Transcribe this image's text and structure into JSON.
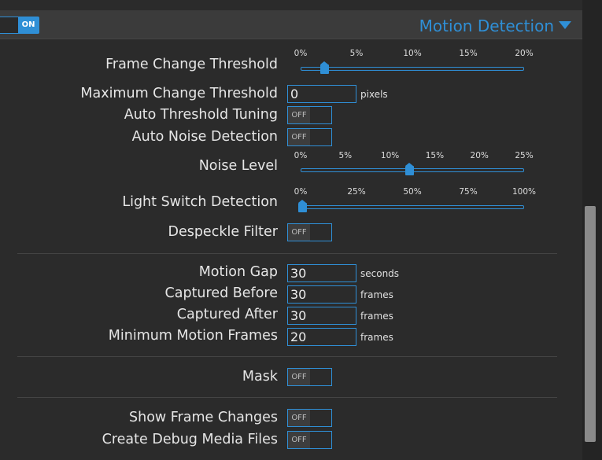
{
  "header": {
    "enable_toggle": "ON",
    "section_title": "Motion Detection"
  },
  "rows": {
    "frame_change_threshold": {
      "label": "Frame Change Threshold",
      "ticks": [
        "0%",
        "5%",
        "10%",
        "15%",
        "20%"
      ],
      "min": 0,
      "max": 20,
      "value": 2
    },
    "max_change_threshold": {
      "label": "Maximum Change Threshold",
      "value": "0",
      "unit": "pixels"
    },
    "auto_threshold_tuning": {
      "label": "Auto Threshold Tuning",
      "state": "OFF"
    },
    "auto_noise_detection": {
      "label": "Auto Noise Detection",
      "state": "OFF"
    },
    "noise_level": {
      "label": "Noise Level",
      "ticks": [
        "0%",
        "5%",
        "10%",
        "15%",
        "20%",
        "25%"
      ],
      "min": 0,
      "max": 25,
      "value": 12
    },
    "light_switch_detection": {
      "label": "Light Switch Detection",
      "ticks": [
        "0%",
        "25%",
        "50%",
        "75%",
        "100%"
      ],
      "min": 0,
      "max": 100,
      "value": 0
    },
    "despeckle_filter": {
      "label": "Despeckle Filter",
      "state": "OFF"
    },
    "motion_gap": {
      "label": "Motion Gap",
      "value": "30",
      "unit": "seconds"
    },
    "captured_before": {
      "label": "Captured Before",
      "value": "30",
      "unit": "frames"
    },
    "captured_after": {
      "label": "Captured After",
      "value": "30",
      "unit": "frames"
    },
    "minimum_motion_frames": {
      "label": "Minimum Motion Frames",
      "value": "20",
      "unit": "frames"
    },
    "mask": {
      "label": "Mask",
      "state": "OFF"
    },
    "show_frame_changes": {
      "label": "Show Frame Changes",
      "state": "OFF"
    },
    "create_debug_media_files": {
      "label": "Create Debug Media Files",
      "state": "OFF"
    }
  },
  "colors": {
    "accent": "#2f8fd6",
    "background": "#2b2b2b",
    "header_background": "#3b3b3b"
  }
}
